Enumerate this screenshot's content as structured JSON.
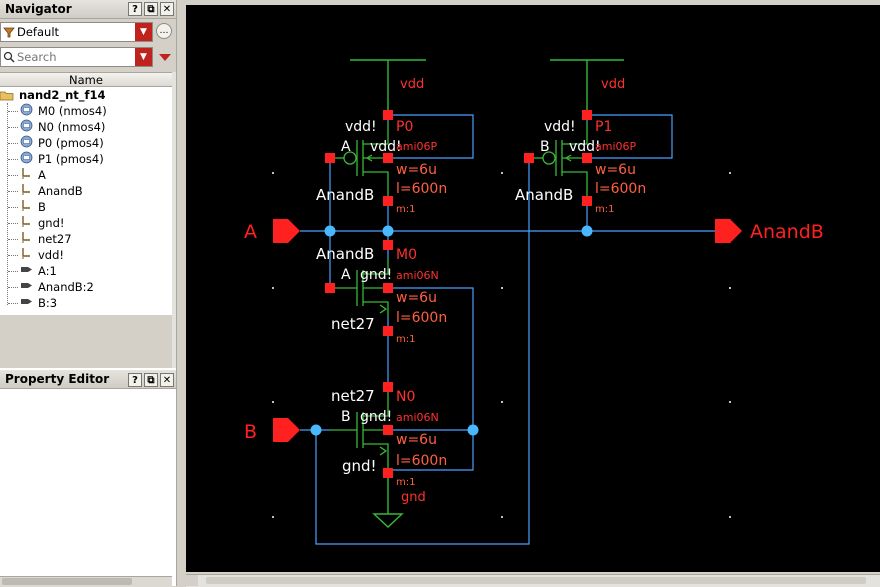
{
  "navigator": {
    "title": "Navigator",
    "filter_value": "Default",
    "search_placeholder": "Search",
    "column_header": "Name",
    "root_label": "nand2_nt_f14",
    "items": [
      {
        "label": "M0 (nmos4)",
        "icon": "instance-icon"
      },
      {
        "label": "N0 (nmos4)",
        "icon": "instance-icon"
      },
      {
        "label": "P0 (pmos4)",
        "icon": "instance-icon"
      },
      {
        "label": "P1 (pmos4)",
        "icon": "instance-icon"
      },
      {
        "label": "A",
        "icon": "net-icon"
      },
      {
        "label": "AnandB",
        "icon": "net-icon"
      },
      {
        "label": "B",
        "icon": "net-icon"
      },
      {
        "label": "gnd!",
        "icon": "net-icon"
      },
      {
        "label": "net27",
        "icon": "net-icon"
      },
      {
        "label": "vdd!",
        "icon": "net-icon"
      },
      {
        "label": "A:1",
        "icon": "pin-icon"
      },
      {
        "label": "AnandB:2",
        "icon": "pin-icon"
      },
      {
        "label": "B:3",
        "icon": "pin-icon"
      }
    ],
    "buttons": {
      "help": "?",
      "float": "⧉",
      "close": "✕"
    }
  },
  "property_editor": {
    "title": "Property Editor",
    "buttons": {
      "help": "?",
      "float": "⧉",
      "close": "✕"
    }
  },
  "schematic": {
    "colors": {
      "background": "#000000",
      "wire": "#4aa0ff",
      "wire_dark": "#3c7fd0",
      "instance": "#38b838",
      "pin": "#ff2020",
      "prop_text": "#ff6040",
      "label": "#ffffff",
      "dot": "#ffffff"
    },
    "labels": {
      "vdd_net_1": "vdd",
      "vdd_net_2": "vdd",
      "p0_name": "P0",
      "p0_model": "ami06P",
      "p0_bulk": "vdd!",
      "p0_w": "w=6u",
      "p0_l": "l=600n",
      "p0_m": "m:1",
      "p0_gate": "A",
      "p0_drain": "AnandB",
      "p0_source": "vdd!",
      "p1_name": "P1",
      "p1_model": "ami06P",
      "p1_bulk": "vdd!",
      "p1_w": "w=6u",
      "p1_l": "l=600n",
      "p1_m": "m:1",
      "p1_gate": "B",
      "p1_drain": "AnandB",
      "p1_source": "vdd!",
      "pin_a": "A",
      "pin_b": "B",
      "pin_out": "AnandB",
      "m0_drain": "AnandB",
      "m0_name": "M0",
      "m0_gate": "A",
      "m0_bulk": "gnd!",
      "m0_model": "ami06N",
      "m0_w": "w=6u",
      "m0_l": "l=600n",
      "m0_m": "m:1",
      "m0_source": "net27",
      "n0_drain": "net27",
      "n0_name": "N0",
      "n0_gate": "B",
      "n0_bulk": "gnd!",
      "n0_model": "ami06N",
      "n0_w": "w=6u",
      "n0_l": "l=600n",
      "n0_m": "m:1",
      "n0_source": "gnd!",
      "gnd_net": "gnd"
    }
  }
}
